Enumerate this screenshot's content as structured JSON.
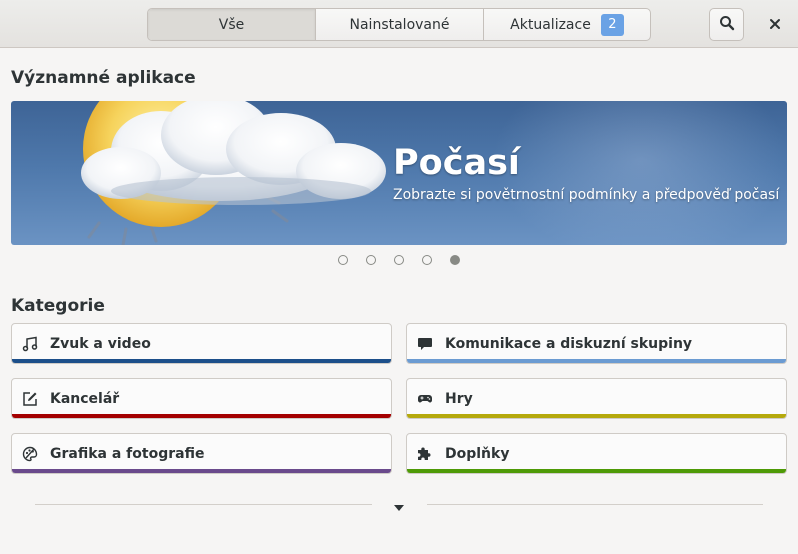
{
  "header": {
    "tabs": [
      {
        "label": "Vše",
        "selected": true
      },
      {
        "label": "Nainstalované",
        "selected": false
      },
      {
        "label": "Aktualizace",
        "selected": false,
        "badge": "2"
      }
    ],
    "search_icon": "search-icon",
    "close_icon": "close-icon"
  },
  "featured": {
    "title": "Významné aplikace",
    "app_name": "Počasí",
    "app_summary": "Zobrazte si povětrnostní podmínky a předpověď počasí",
    "carousel_pages": 5,
    "carousel_active": 5
  },
  "categories": {
    "title": "Kategorie",
    "items": [
      {
        "label": "Zvuk a video",
        "icon": "music-note-icon",
        "color": "#1c4f8a"
      },
      {
        "label": "Komunikace a diskuzní skupiny",
        "icon": "chat-bubble-icon",
        "color": "#6b9bd2"
      },
      {
        "label": "Kancelář",
        "icon": "edit-document-icon",
        "color": "#a40000"
      },
      {
        "label": "Hry",
        "icon": "gamepad-icon",
        "color": "#b5a90c"
      },
      {
        "label": "Grafika a fotografie",
        "icon": "palette-icon",
        "color": "#6a4a8c"
      },
      {
        "label": "Doplňky",
        "icon": "puzzle-piece-icon",
        "color": "#4e9a06"
      }
    ]
  },
  "more_icon": "chevron-down-icon"
}
